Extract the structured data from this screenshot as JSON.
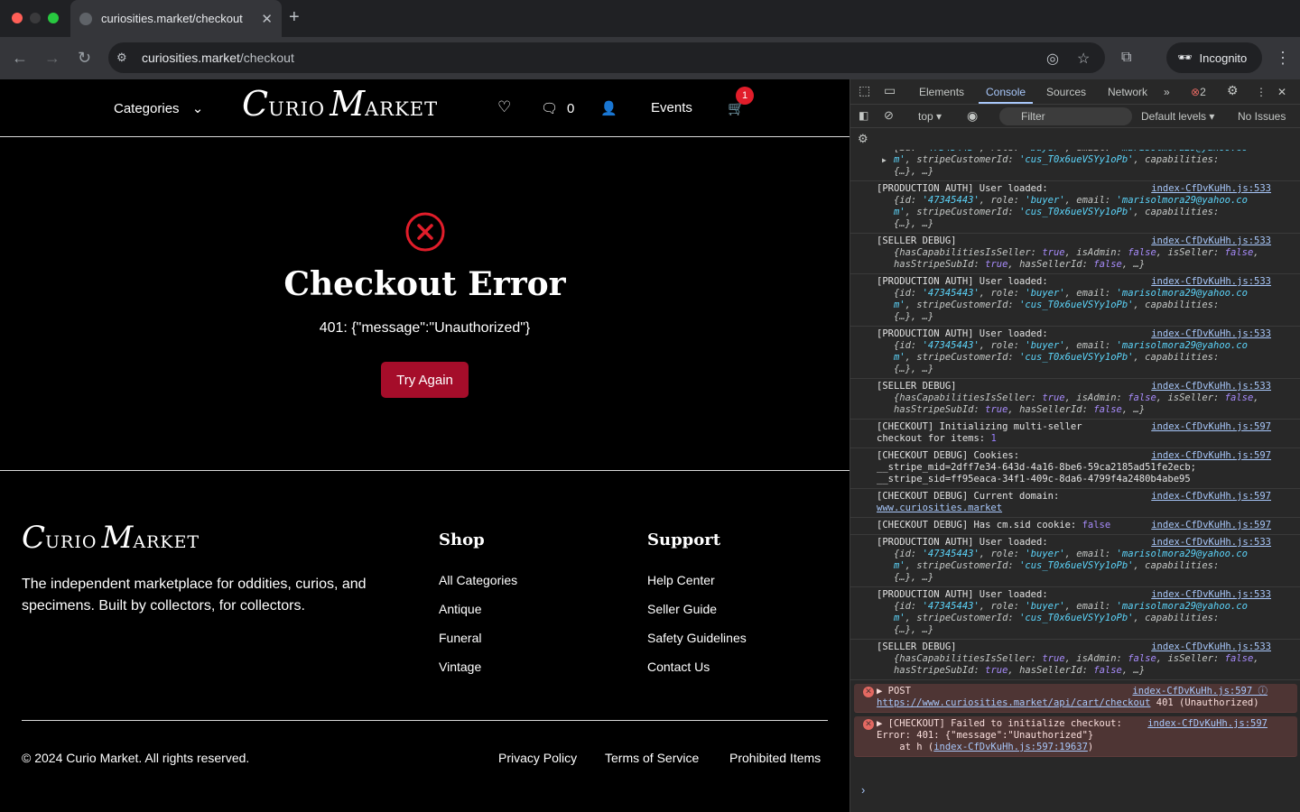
{
  "browser": {
    "tab_title": "curiosities.market/checkout",
    "url_host": "curiosities.market",
    "url_path": "/checkout",
    "incognito_label": "Incognito",
    "accent": "#a8c7fa"
  },
  "site": {
    "header": {
      "categories_label": "Categories",
      "logo_c": "C",
      "logo_urio": "URIO",
      "logo_m": "M",
      "logo_arket": "ARKET",
      "messages_count": "0",
      "events_label": "Events",
      "cart_count": "1"
    },
    "error": {
      "title": "Checkout Error",
      "message": "401: {\"message\":\"Unauthorized\"}",
      "button": "Try Again",
      "color": "#a50d2a"
    },
    "footer": {
      "description": "The independent marketplace for oddities, curios, and specimens. Built by collectors, for collectors.",
      "shop_heading": "Shop",
      "shop_links": [
        "All Categories",
        "Antique",
        "Funeral",
        "Vintage"
      ],
      "support_heading": "Support",
      "support_links": [
        "Help Center",
        "Seller Guide",
        "Safety Guidelines",
        "Contact Us"
      ],
      "copyright": "© 2024 Curio Market. All rights reserved.",
      "legal_links": [
        "Privacy Policy",
        "Terms of Service",
        "Prohibited Items"
      ]
    }
  },
  "devtools": {
    "tabs": [
      "Elements",
      "Console",
      "Sources",
      "Network"
    ],
    "error_count": "2",
    "context": "top",
    "filter_placeholder": "Filter",
    "levels": "Default levels",
    "issues": "No Issues"
  }
}
